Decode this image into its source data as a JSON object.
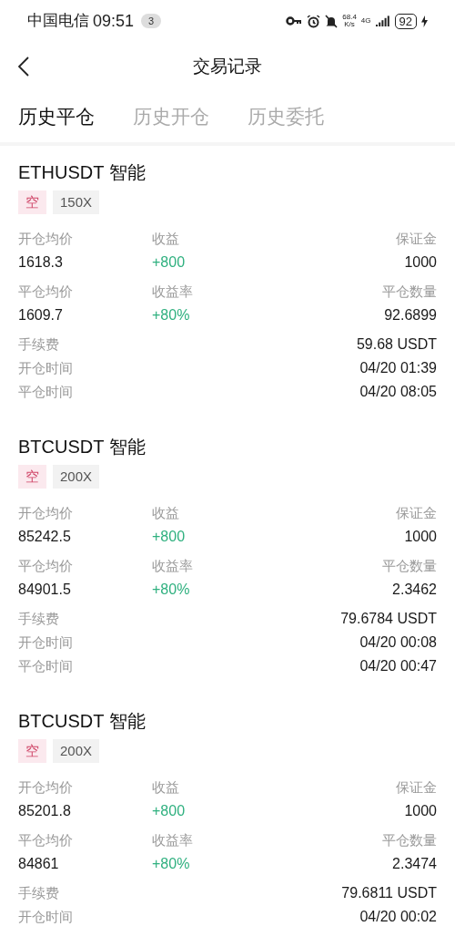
{
  "status_bar": {
    "carrier": "中国电信",
    "time": "09:51",
    "notification_count": "3",
    "net_speed": "68.4",
    "net_unit": "K/s",
    "network": "4G",
    "battery": "92"
  },
  "header": {
    "title": "交易记录"
  },
  "tabs": [
    {
      "label": "历史平仓",
      "selected": true
    },
    {
      "label": "历史开仓",
      "selected": false
    },
    {
      "label": "历史委托",
      "selected": false
    }
  ],
  "records": [
    {
      "symbol": "ETHUSDT 智能",
      "tags": [
        {
          "kind": "side",
          "text": "空"
        },
        {
          "kind": "leverage",
          "text": "150X"
        }
      ],
      "grid": [
        [
          {
            "label": "开仓均价",
            "value": "1618.3",
            "kind": "plain"
          },
          {
            "label": "收益",
            "value": "+800",
            "kind": "gain"
          },
          {
            "label": "保证金",
            "value": "1000",
            "kind": "plain"
          }
        ],
        [
          {
            "label": "平仓均价",
            "value": "1609.7",
            "kind": "plain"
          },
          {
            "label": "收益率",
            "value": "+80%",
            "kind": "gain"
          },
          {
            "label": "平仓数量",
            "value": "92.6899",
            "kind": "plain"
          }
        ]
      ],
      "details": [
        {
          "label": "手续费",
          "value": "59.68 USDT"
        },
        {
          "label": "开仓时间",
          "value": "04/20 01:39"
        },
        {
          "label": "平仓时间",
          "value": "04/20 08:05"
        }
      ]
    },
    {
      "symbol": "BTCUSDT 智能",
      "tags": [
        {
          "kind": "side",
          "text": "空"
        },
        {
          "kind": "leverage",
          "text": "200X"
        }
      ],
      "grid": [
        [
          {
            "label": "开仓均价",
            "value": "85242.5",
            "kind": "plain"
          },
          {
            "label": "收益",
            "value": "+800",
            "kind": "gain"
          },
          {
            "label": "保证金",
            "value": "1000",
            "kind": "plain"
          }
        ],
        [
          {
            "label": "平仓均价",
            "value": "84901.5",
            "kind": "plain"
          },
          {
            "label": "收益率",
            "value": "+80%",
            "kind": "gain"
          },
          {
            "label": "平仓数量",
            "value": "2.3462",
            "kind": "plain"
          }
        ]
      ],
      "details": [
        {
          "label": "手续费",
          "value": "79.6784 USDT"
        },
        {
          "label": "开仓时间",
          "value": "04/20 00:08"
        },
        {
          "label": "平仓时间",
          "value": "04/20 00:47"
        }
      ]
    },
    {
      "symbol": "BTCUSDT 智能",
      "tags": [
        {
          "kind": "side",
          "text": "空"
        },
        {
          "kind": "leverage",
          "text": "200X"
        }
      ],
      "grid": [
        [
          {
            "label": "开仓均价",
            "value": "85201.8",
            "kind": "plain"
          },
          {
            "label": "收益",
            "value": "+800",
            "kind": "gain"
          },
          {
            "label": "保证金",
            "value": "1000",
            "kind": "plain"
          }
        ],
        [
          {
            "label": "平仓均价",
            "value": "84861",
            "kind": "plain"
          },
          {
            "label": "收益率",
            "value": "+80%",
            "kind": "gain"
          },
          {
            "label": "平仓数量",
            "value": "2.3474",
            "kind": "plain"
          }
        ]
      ],
      "details": [
        {
          "label": "手续费",
          "value": "79.6811 USDT"
        },
        {
          "label": "开仓时间",
          "value": "04/20 00:02"
        }
      ]
    }
  ]
}
